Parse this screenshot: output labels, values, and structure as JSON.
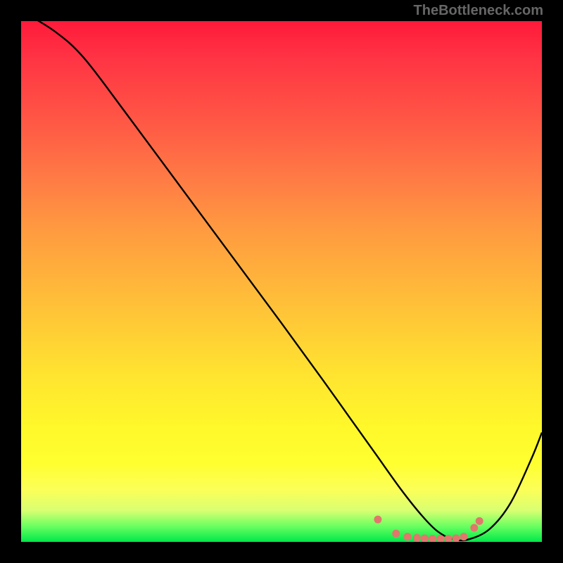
{
  "attribution": "TheBottleneck.com",
  "chart_data": {
    "type": "line",
    "title": "",
    "xlabel": "",
    "ylabel": "",
    "xlim": [
      0,
      100
    ],
    "ylim": [
      0,
      100
    ],
    "series": [
      {
        "name": "bottleneck-curve",
        "color": "#000000",
        "x": [
          0,
          6.5,
          12,
          20,
          30,
          40,
          50,
          58,
          63,
          68,
          73,
          77,
          80,
          83,
          86,
          90,
          94,
          98,
          100
        ],
        "y": [
          102,
          98,
          93,
          82.5,
          69,
          55.5,
          42,
          31,
          24,
          17,
          10,
          5,
          2,
          0.5,
          0.5,
          2.5,
          7.5,
          16,
          21
        ]
      }
    ],
    "minimum_markers": {
      "color": "#e2766d",
      "points": [
        {
          "x": 68.5,
          "y": 4.3
        },
        {
          "x": 72.0,
          "y": 1.6
        },
        {
          "x": 74.2,
          "y": 1.0
        },
        {
          "x": 76.0,
          "y": 0.8
        },
        {
          "x": 77.5,
          "y": 0.7
        },
        {
          "x": 79.0,
          "y": 0.6
        },
        {
          "x": 80.5,
          "y": 0.6
        },
        {
          "x": 82.0,
          "y": 0.6
        },
        {
          "x": 83.5,
          "y": 0.7
        },
        {
          "x": 85.0,
          "y": 1.0
        },
        {
          "x": 87.0,
          "y": 2.7
        },
        {
          "x": 88.0,
          "y": 4.0
        }
      ]
    }
  },
  "palette": {
    "background": "#000000",
    "curve": "#000000",
    "marker": "#e2766d"
  }
}
